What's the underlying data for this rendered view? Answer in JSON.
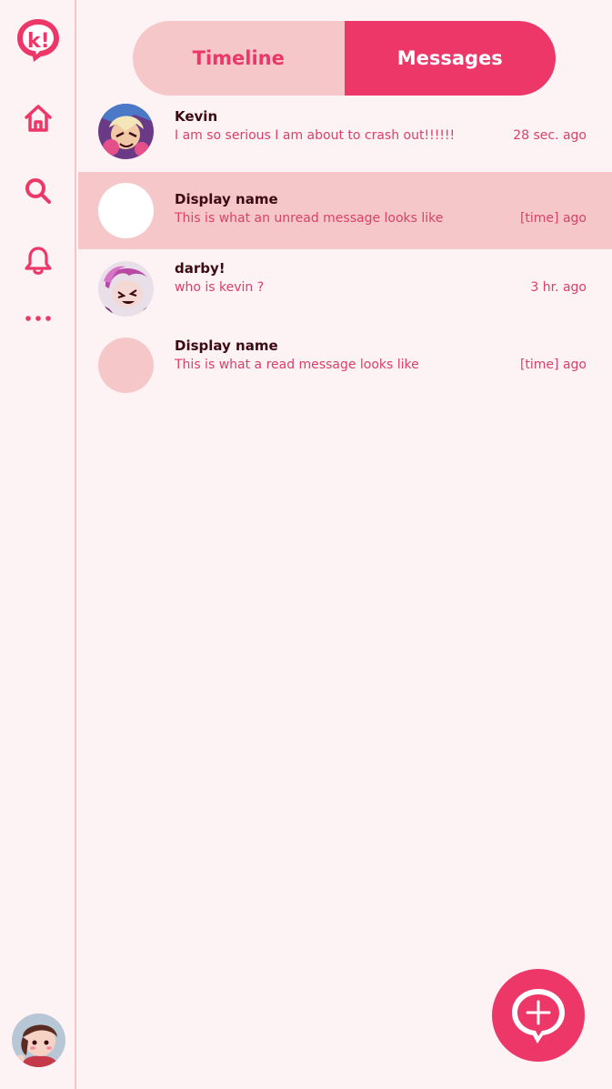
{
  "tabs": {
    "timeline": "Timeline",
    "messages": "Messages",
    "active": "messages"
  },
  "colors": {
    "accent": "#ec3768",
    "accent_light": "#f6c7c9",
    "background": "#fdf2f4",
    "text_dark": "#3b0a12",
    "text_pink": "#d9416a"
  },
  "sidebar": {
    "logo_text": "k!",
    "items": [
      {
        "icon": "home-icon"
      },
      {
        "icon": "search-icon"
      },
      {
        "icon": "bell-icon"
      },
      {
        "icon": "more-icon"
      }
    ]
  },
  "messages": [
    {
      "sender": "Kevin",
      "preview": "I am so serious I am about to crash out!!!!!!",
      "time": "28 sec. ago",
      "unread": false
    },
    {
      "sender": "Display name",
      "preview": "This is what an unread message looks like",
      "time": "[time] ago",
      "unread": true
    },
    {
      "sender": "darby!",
      "preview": "who is kevin ?",
      "time": "3 hr. ago",
      "unread": false
    },
    {
      "sender": "Display name",
      "preview": "This is what a read message looks like",
      "time": "[time] ago",
      "unread": false
    }
  ],
  "fab": {
    "icon": "new-message-icon"
  }
}
